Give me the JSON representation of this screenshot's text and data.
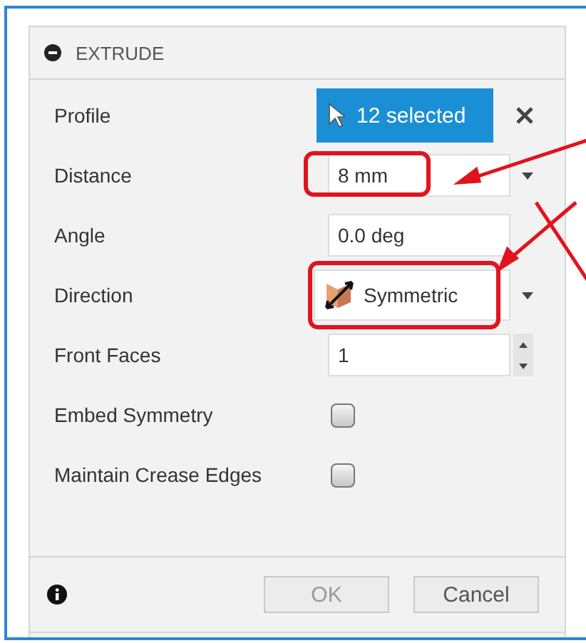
{
  "panel": {
    "title": "EXTRUDE"
  },
  "rows": [
    {
      "kind": "select",
      "label": "Profile",
      "value": "12 selected"
    },
    {
      "kind": "dropdown",
      "label": "Distance",
      "value": "8 mm",
      "highlighted": true
    },
    {
      "kind": "text",
      "label": "Angle",
      "value": "0.0 deg"
    },
    {
      "kind": "direction",
      "label": "Direction",
      "value": "Symmetric",
      "highlighted": true
    },
    {
      "kind": "spinner",
      "label": "Front Faces",
      "value": "1"
    },
    {
      "kind": "checkbox",
      "label": "Embed Symmetry",
      "checked": false
    },
    {
      "kind": "checkbox",
      "label": "Maintain Crease Edges",
      "checked": false
    }
  ],
  "buttons": [
    {
      "label": "OK",
      "disabled": true
    },
    {
      "label": "Cancel",
      "disabled": false
    }
  ]
}
